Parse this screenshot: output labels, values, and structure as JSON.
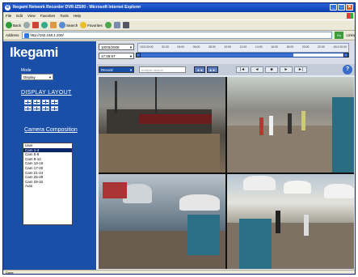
{
  "window": {
    "title": "Ikegami Network Recorder DVR-IZS00 - Microsoft Internet Explorer",
    "buttons": [
      "_",
      "□",
      "✕"
    ]
  },
  "menu": [
    "File",
    "Edit",
    "View",
    "Favorites",
    "Tools",
    "Help"
  ],
  "toolbar": {
    "back": "Back",
    "search": "Search",
    "favorites": "Favorites"
  },
  "address": {
    "label": "Address",
    "url": "http://192.168.1.200/",
    "go": "Go",
    "links": "Links"
  },
  "sidebar": {
    "logo": "Ikegami",
    "mode_label": "Mode",
    "mode_value": "Display",
    "display_layout": "DISPLAY LAYOUT",
    "camera_composition": "Camera Composition",
    "camera_list": [
      "User",
      "Cam 1-4",
      "Cam 5-8",
      "Cam 9-12",
      "Cam 13-16",
      "Cam 17-20",
      "Cam 21-24",
      "Cam 25-28",
      "Cam 29-32",
      "Auto"
    ],
    "selected_index": 1
  },
  "controls": {
    "date": "10/03/2008",
    "time": "17:46:57",
    "channel": "Record",
    "search_placeholder": "multiple search",
    "timeline_labels": [
      "10/3 00:00",
      "02:00",
      "04:00",
      "06:00",
      "08:00",
      "10:00",
      "12:00",
      "14:00",
      "16:00",
      "18:00",
      "20:00",
      "22:00",
      "10/4 00:00"
    ],
    "timeline_progress": 0.74,
    "play_buttons": [
      "◄◄",
      "►►"
    ],
    "transport_buttons": [
      "|◄",
      "◄",
      "■",
      "►",
      "►|"
    ],
    "help": "?"
  },
  "status": {
    "text": "Done"
  },
  "colors": {
    "sidebar_bg": "#1a4fa8",
    "accent": "#3b6fd0"
  }
}
